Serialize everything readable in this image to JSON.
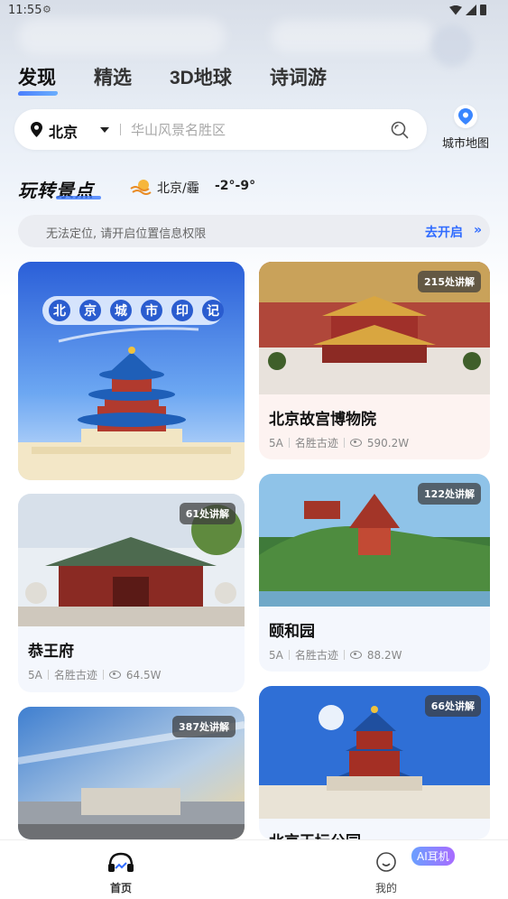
{
  "status_bar": {
    "time": "11:55"
  },
  "tabs": [
    {
      "label": "发现",
      "active": true
    },
    {
      "label": "精选",
      "active": false
    },
    {
      "label": "3D地球",
      "active": false
    },
    {
      "label": "诗词游",
      "active": false
    }
  ],
  "search": {
    "city": "北京",
    "placeholder": "华山风景名胜区"
  },
  "city_map": {
    "label": "城市地图"
  },
  "section": {
    "title": "玩转景点",
    "weather": "北京/霾",
    "temperature": "-2°-9°"
  },
  "location_banner": {
    "text": "无法定位, 请开启位置信息权限",
    "action": "去开启"
  },
  "cards": {
    "banner": {
      "title_chars": [
        "北",
        "京",
        "城",
        "市",
        "印",
        "记"
      ]
    },
    "gugong": {
      "badge": "215处讲解",
      "name": "北京故宫博物院",
      "level": "5A",
      "category": "名胜古迹",
      "views": "590.2W"
    },
    "gongwangfu": {
      "badge": "61处讲解",
      "name": "恭王府",
      "level": "5A",
      "category": "名胜古迹",
      "views": "64.5W"
    },
    "yiheyuan": {
      "badge": "122处讲解",
      "name": "颐和园",
      "level": "5A",
      "category": "名胜古迹",
      "views": "88.2W"
    },
    "museum": {
      "badge": "387处讲解"
    },
    "tiantan": {
      "badge": "66处讲解",
      "name": "北京天坛公园"
    }
  },
  "bottom_nav": {
    "home": "首页",
    "mine": "我的",
    "ai_badge": "AI耳机"
  },
  "colors": {
    "accent": "#2f6bff",
    "badge_bg": "#3c3c3c"
  }
}
